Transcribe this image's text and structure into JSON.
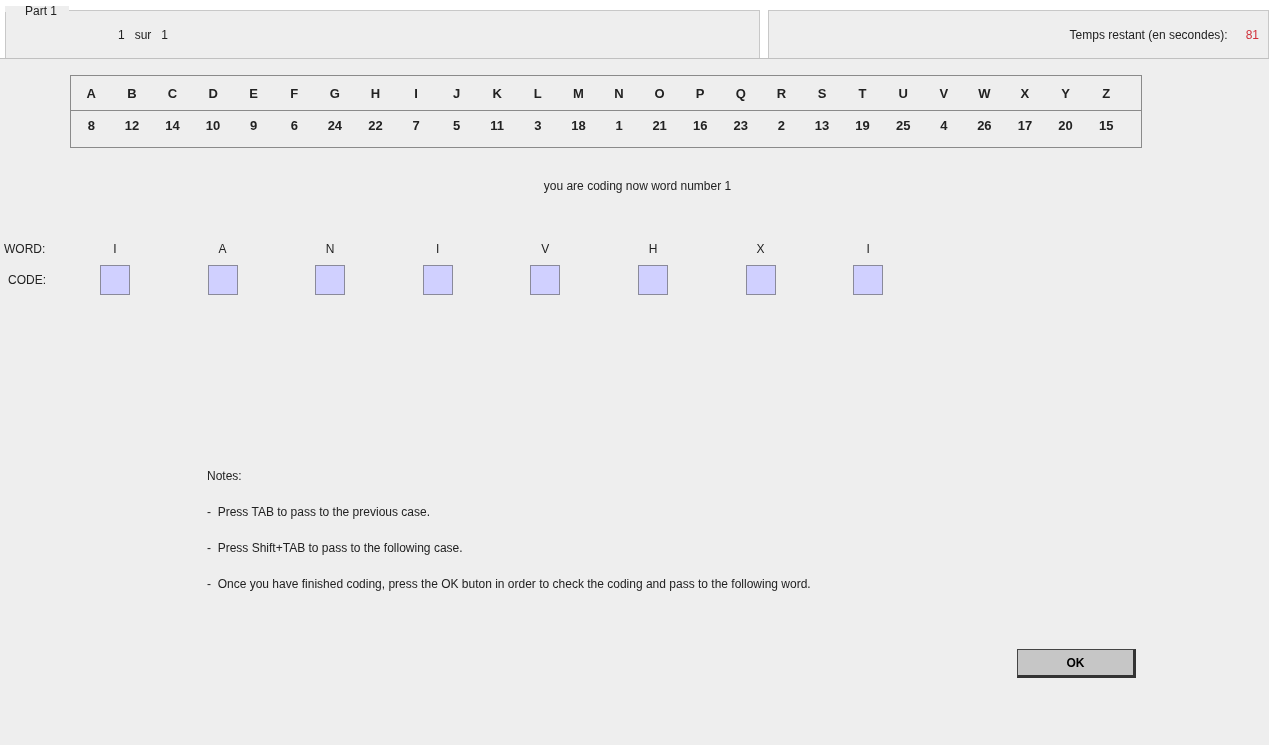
{
  "part_panel": {
    "title": "Part 1",
    "current": "1",
    "separator": "sur",
    "total": "1"
  },
  "timer": {
    "label": "Temps restant (en secondes):",
    "value": "81"
  },
  "cipher": [
    {
      "letter": "A",
      "code": "8"
    },
    {
      "letter": "B",
      "code": "12"
    },
    {
      "letter": "C",
      "code": "14"
    },
    {
      "letter": "D",
      "code": "10"
    },
    {
      "letter": "E",
      "code": "9"
    },
    {
      "letter": "F",
      "code": "6"
    },
    {
      "letter": "G",
      "code": "24"
    },
    {
      "letter": "H",
      "code": "22"
    },
    {
      "letter": "I",
      "code": "7"
    },
    {
      "letter": "J",
      "code": "5"
    },
    {
      "letter": "K",
      "code": "11"
    },
    {
      "letter": "L",
      "code": "3"
    },
    {
      "letter": "M",
      "code": "18"
    },
    {
      "letter": "N",
      "code": "1"
    },
    {
      "letter": "O",
      "code": "21"
    },
    {
      "letter": "P",
      "code": "16"
    },
    {
      "letter": "Q",
      "code": "23"
    },
    {
      "letter": "R",
      "code": "2"
    },
    {
      "letter": "S",
      "code": "13"
    },
    {
      "letter": "T",
      "code": "19"
    },
    {
      "letter": "U",
      "code": "25"
    },
    {
      "letter": "V",
      "code": "4"
    },
    {
      "letter": "W",
      "code": "26"
    },
    {
      "letter": "X",
      "code": "17"
    },
    {
      "letter": "Y",
      "code": "20"
    },
    {
      "letter": "Z",
      "code": "15"
    }
  ],
  "status": "you are coding now word number 1",
  "word": {
    "word_label": "WORD:",
    "code_label": "CODE:",
    "letters": [
      "I",
      "A",
      "N",
      "I",
      "V",
      "H",
      "X",
      "I"
    ]
  },
  "notes": {
    "title": "Notes:",
    "items": [
      "-  Press TAB to pass to the previous case.",
      "-  Press Shift+TAB to pass to the following case.",
      "-  Once you have finished coding, press the OK buton in order to check the coding and pass to the following word."
    ]
  },
  "ok_button": "OK"
}
